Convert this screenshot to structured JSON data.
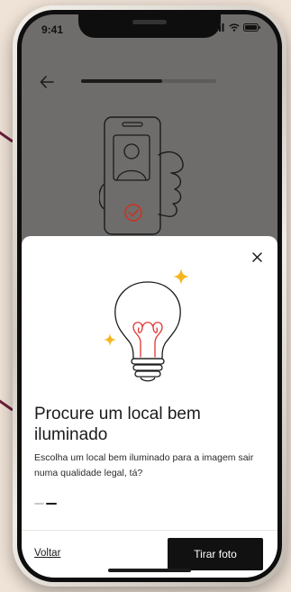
{
  "status_bar": {
    "time": "9:41"
  },
  "header": {
    "progress": 0.6
  },
  "sheet": {
    "title": "Procure um local bem iluminado",
    "description": "Escolha um local bem iluminado para a imagem sair numa qualidade legal, tá?",
    "pagination": {
      "total": 2,
      "current": 2
    }
  },
  "footer": {
    "back_label": "Voltar",
    "primary_label": "Tirar foto"
  },
  "colors": {
    "background": "#efe2d6",
    "accent_line": "#6b1e3a",
    "sparkle": "#f5b51c",
    "filament": "#e0322e",
    "overlay": "#6f6d6b",
    "button": "#111111"
  },
  "icons": [
    "back-arrow-icon",
    "close-icon",
    "lightbulb-icon",
    "sparkle-icon",
    "phone-selfie-illustration",
    "check-circle-icon",
    "signal-icon",
    "wifi-icon",
    "battery-icon"
  ]
}
